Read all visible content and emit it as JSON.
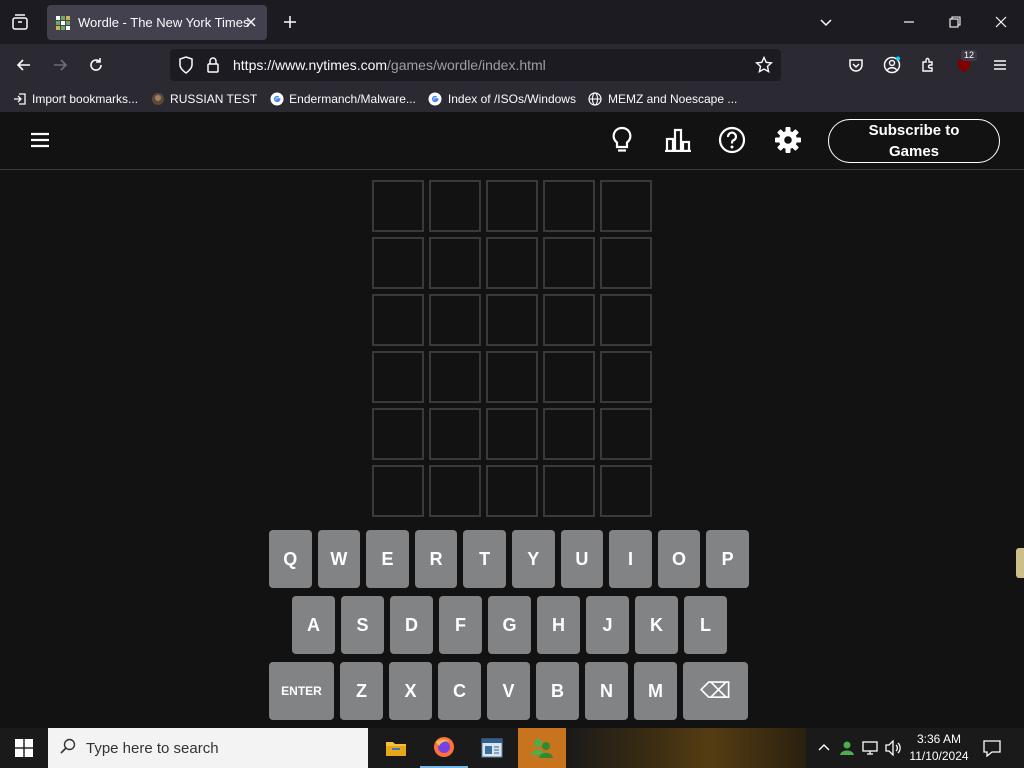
{
  "browser": {
    "tab_title": "Wordle - The New York Times",
    "url_host": "https://www.nytimes.com",
    "url_path": "/games/wordle/index.html",
    "extension_badge": "12",
    "bookmarks": [
      {
        "label": "Import bookmarks...",
        "icon": "import-icon"
      },
      {
        "label": "RUSSIAN TEST",
        "icon": "site-icon"
      },
      {
        "label": "Endermanch/Malware...",
        "icon": "google-icon"
      },
      {
        "label": "Index of /ISOs/Windows",
        "icon": "google-icon"
      },
      {
        "label": "MEMZ and Noescape ...",
        "icon": "globe-icon"
      }
    ]
  },
  "game": {
    "subscribe_label": "Subscribe to Games",
    "rows": 6,
    "cols": 5,
    "keyboard": [
      [
        "Q",
        "W",
        "E",
        "R",
        "T",
        "Y",
        "U",
        "I",
        "O",
        "P"
      ],
      [
        "A",
        "S",
        "D",
        "F",
        "G",
        "H",
        "J",
        "K",
        "L"
      ],
      [
        "ENTER",
        "Z",
        "X",
        "C",
        "V",
        "B",
        "N",
        "M",
        "⌫"
      ]
    ]
  },
  "taskbar": {
    "search_placeholder": "Type here to search",
    "time": "3:36 AM",
    "date": "11/10/2024"
  },
  "colors": {
    "page_bg": "#121213",
    "tile_border": "#3a3a3c",
    "key_bg": "#818384",
    "chrome_bg": "#2b2a33"
  }
}
